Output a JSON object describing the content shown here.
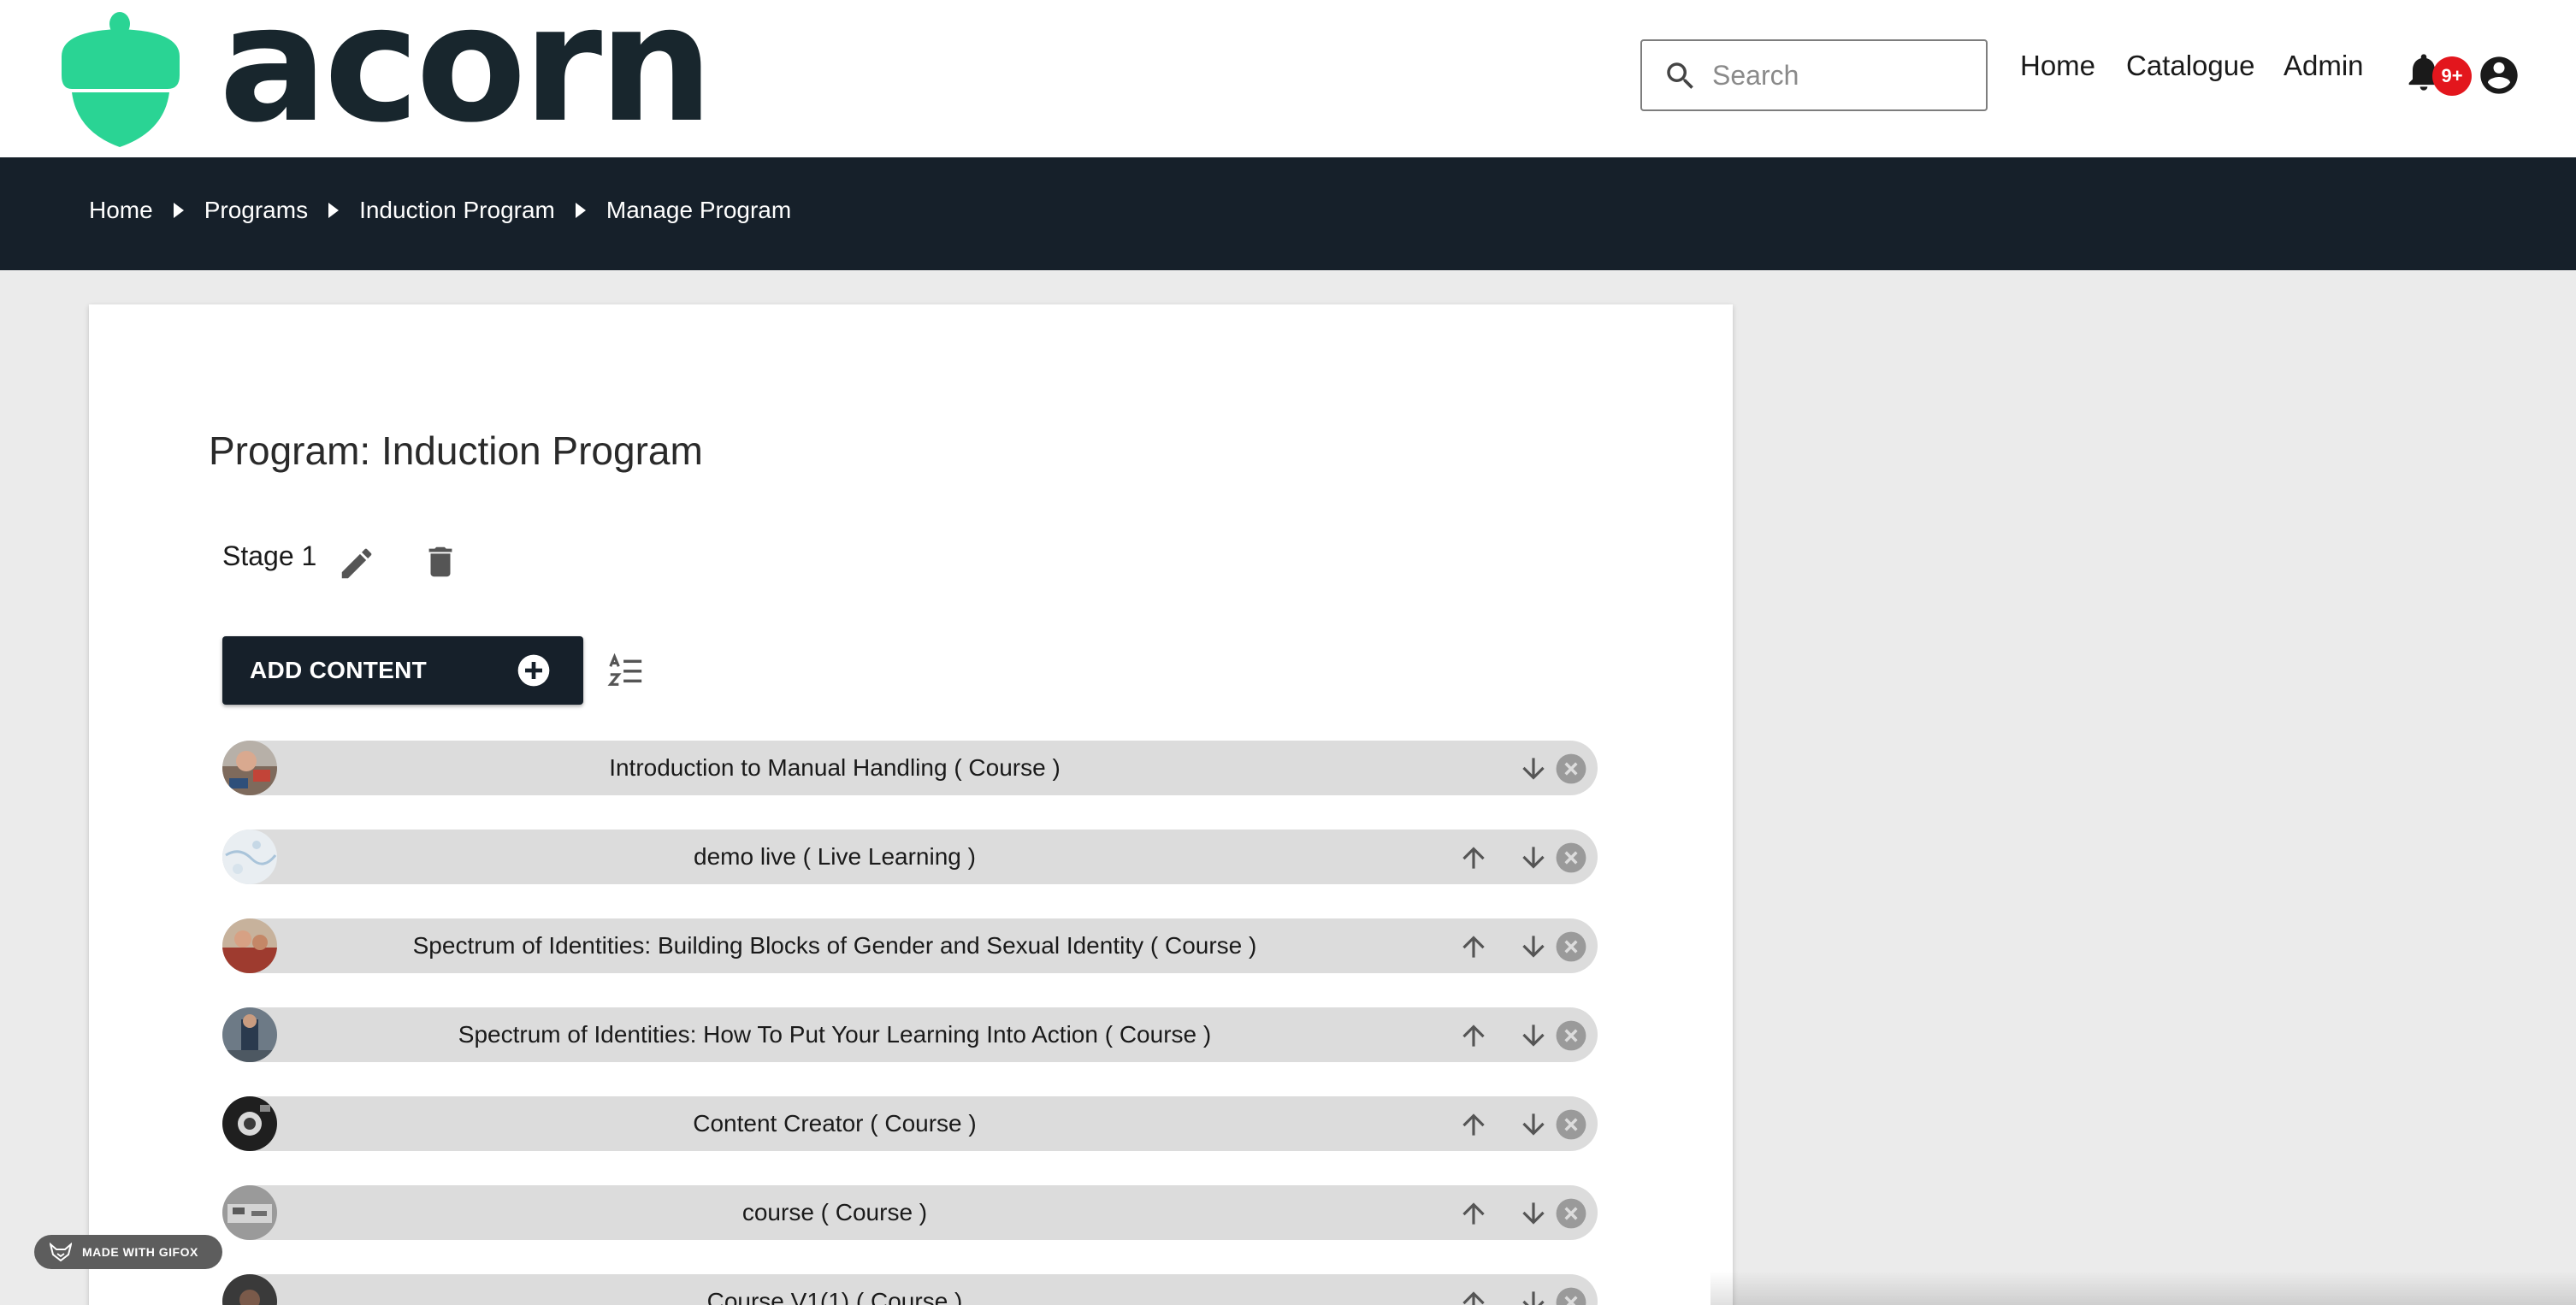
{
  "header": {
    "logo_text": "acorn",
    "search": {
      "placeholder": "Search",
      "value": ""
    },
    "nav": [
      "Home",
      "Catalogue",
      "Admin"
    ],
    "notification_badge": "9+",
    "icons": {
      "search": "search-icon",
      "bell": "bell-icon",
      "account": "account-circle-icon"
    },
    "colors": {
      "logo_green": "#2ad494",
      "badge_red": "#e3161d"
    }
  },
  "breadcrumb": [
    "Home",
    "Programs",
    "Induction Program",
    "Manage Program"
  ],
  "main": {
    "program_title": "Program: Induction Program",
    "stage": {
      "label": "Stage 1"
    },
    "add_content_label": "ADD CONTENT",
    "items": [
      {
        "title": "Introduction to Manual Handling ( Course )",
        "can_move_up": false
      },
      {
        "title": "demo live ( Live Learning )",
        "can_move_up": true
      },
      {
        "title": "Spectrum of Identities: Building Blocks of Gender and Sexual Identity ( Course )",
        "can_move_up": true
      },
      {
        "title": "Spectrum of Identities: How To Put Your Learning Into Action ( Course )",
        "can_move_up": true
      },
      {
        "title": "Content Creator ( Course )",
        "can_move_up": true
      },
      {
        "title": "course ( Course )",
        "can_move_up": true
      },
      {
        "title": "Course V1(1) ( Course )",
        "can_move_up": true
      }
    ]
  },
  "watermark": "MADE WITH GIFOX",
  "theme": {
    "dark_bar": "#16202a",
    "row_bg": "#dcdcdc",
    "page_bg": "#ebebeb"
  }
}
